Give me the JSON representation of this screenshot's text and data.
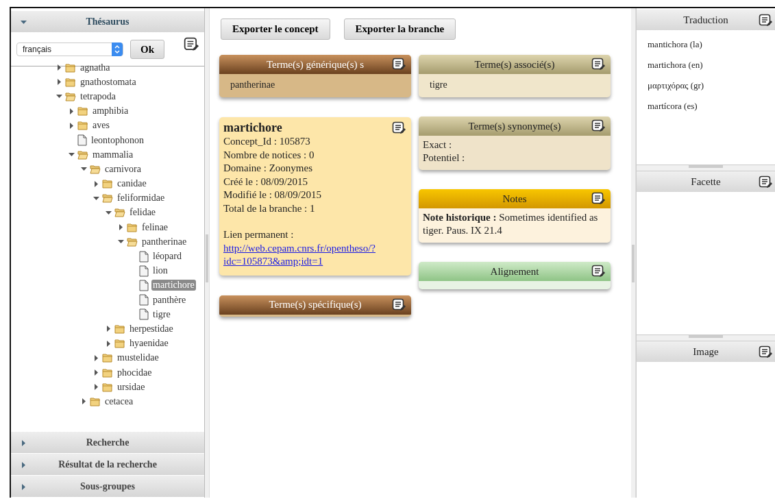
{
  "left_panel": {
    "thesaurus": {
      "title": "Thésaurus",
      "expanded": true,
      "language": "français",
      "ok_button": "Ok"
    },
    "tree": [
      {
        "label": "agnatha",
        "kind": "folder",
        "expanded": false,
        "selected": false
      },
      {
        "label": "gnathostomata",
        "kind": "folder",
        "expanded": false,
        "selected": false
      },
      {
        "label": "tetrapoda",
        "kind": "folder",
        "expanded": true,
        "selected": false,
        "children": [
          {
            "label": "amphibia",
            "kind": "folder",
            "expanded": false,
            "selected": false
          },
          {
            "label": "aves",
            "kind": "folder",
            "expanded": false,
            "selected": false
          },
          {
            "label": "leontophonon",
            "kind": "concept",
            "selected": false
          },
          {
            "label": "mammalia",
            "kind": "folder",
            "expanded": true,
            "selected": false,
            "children": [
              {
                "label": "carnivora",
                "kind": "folder",
                "expanded": true,
                "selected": false,
                "children": [
                  {
                    "label": "canidae",
                    "kind": "folder",
                    "expanded": false,
                    "selected": false
                  },
                  {
                    "label": "feliformidae",
                    "kind": "folder",
                    "expanded": true,
                    "selected": false,
                    "children": [
                      {
                        "label": "felidae",
                        "kind": "folder",
                        "expanded": true,
                        "selected": false,
                        "children": [
                          {
                            "label": "felinae",
                            "kind": "folder",
                            "expanded": false,
                            "selected": false
                          },
                          {
                            "label": "pantherinae",
                            "kind": "folder",
                            "expanded": true,
                            "selected": false,
                            "children": [
                              {
                                "label": "léopard",
                                "kind": "concept",
                                "selected": false
                              },
                              {
                                "label": "lion",
                                "kind": "concept",
                                "selected": false
                              },
                              {
                                "label": "martichore",
                                "kind": "concept",
                                "selected": true
                              },
                              {
                                "label": "panthère",
                                "kind": "concept",
                                "selected": false
                              },
                              {
                                "label": "tigre",
                                "kind": "concept",
                                "selected": false
                              }
                            ]
                          }
                        ]
                      },
                      {
                        "label": "herpestidae",
                        "kind": "folder",
                        "expanded": false,
                        "selected": false
                      },
                      {
                        "label": "hyaenidae",
                        "kind": "folder",
                        "expanded": false,
                        "selected": false
                      }
                    ]
                  },
                  {
                    "label": "mustelidae",
                    "kind": "folder",
                    "expanded": false,
                    "selected": false
                  },
                  {
                    "label": "phocidae",
                    "kind": "folder",
                    "expanded": false,
                    "selected": false
                  },
                  {
                    "label": "ursidae",
                    "kind": "folder",
                    "expanded": false,
                    "selected": false
                  }
                ]
              },
              {
                "label": "cetacea",
                "kind": "folder",
                "expanded": false,
                "selected": false
              }
            ]
          }
        ]
      }
    ],
    "sections": [
      {
        "title": "Recherche",
        "expanded": false
      },
      {
        "title": "Résultat de la recherche",
        "expanded": false
      },
      {
        "title": "Sous-groupes",
        "expanded": false
      }
    ]
  },
  "toolbar": [
    "Exporter le concept",
    "Exporter la branche"
  ],
  "left_cards": [
    {
      "kind": "generic",
      "title": "Terme(s) générique(s) s",
      "items": [
        "pantherinae"
      ]
    },
    {
      "kind": "concept",
      "title": "martichore",
      "fields": [
        "Concept_Id : 105873",
        "Nombre de notices : 0",
        "Domaine : Zoonymes",
        "Créé le : 08/09/2015",
        "Modifié le : 08/09/2015",
        "Total de la branche : 1"
      ],
      "permalink_label": "Lien permanent :",
      "permalink": "http://web.cepam.cnrs.fr/opentheso/?idc=105873&amp;idt=1"
    },
    {
      "kind": "specific",
      "title": "Terme(s) spécifique(s)"
    }
  ],
  "right_cards": [
    {
      "kind": "associated",
      "title": "Terme(s) associé(s)",
      "items": [
        "tigre"
      ]
    },
    {
      "kind": "synonyms",
      "title": "Terme(s) synonyme(s)",
      "lines": [
        "Exact :",
        "Potentiel :"
      ]
    },
    {
      "kind": "notes",
      "title": "Notes",
      "lines": [
        "**Note historique :** Sometimes identified as tiger. Paus. IX 21.4"
      ]
    },
    {
      "kind": "alignment",
      "title": "Alignement"
    }
  ],
  "right_panel": [
    {
      "title": "Traduction",
      "items": [
        "mantichora (la)",
        "martichora (en)",
        "μαρτιχόρας (gr)",
        "martícora (es)"
      ]
    },
    {
      "title": "Facette"
    },
    {
      "title": "Image"
    }
  ]
}
